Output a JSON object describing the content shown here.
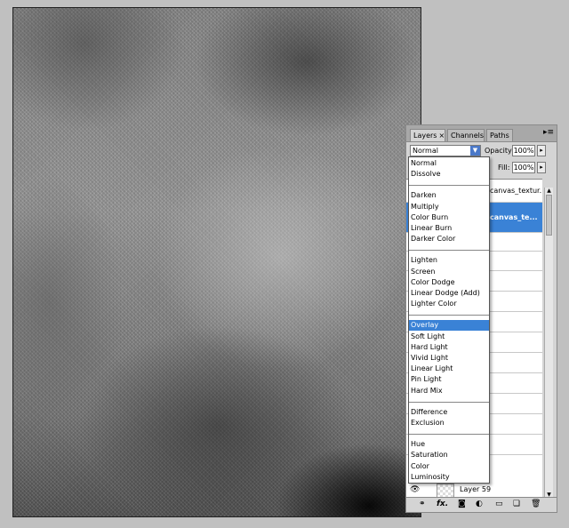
{
  "panel": {
    "tabs": [
      {
        "label": "Layers",
        "close": "×"
      },
      {
        "label": "Channels"
      },
      {
        "label": "Paths"
      }
    ],
    "menu_icon": "panel-menu-icon",
    "blend_mode": "Normal",
    "opacity_label": "Opacity:",
    "opacity_value": "100%",
    "fill_label": "Fill:",
    "fill_value": "100%",
    "layers": [
      {
        "name": "canvas_textur..."
      },
      {
        "name": "canvas_te..."
      },
      {
        "name": "Layer 59"
      }
    ],
    "footer_icons": [
      "link-icon",
      "fx-icon",
      "mask-icon",
      "adjustment-icon",
      "group-icon",
      "new-layer-icon",
      "trash-icon"
    ],
    "footer_fx_label": "fx."
  },
  "dropdown": {
    "groups": [
      [
        "Normal",
        "Dissolve"
      ],
      [
        "Darken",
        "Multiply",
        "Color Burn",
        "Linear Burn",
        "Darker Color"
      ],
      [
        "Lighten",
        "Screen",
        "Color Dodge",
        "Linear Dodge (Add)",
        "Lighter Color"
      ],
      [
        "Overlay",
        "Soft Light",
        "Hard Light",
        "Vivid Light",
        "Linear Light",
        "Pin Light",
        "Hard Mix"
      ],
      [
        "Difference",
        "Exclusion"
      ],
      [
        "Hue",
        "Saturation",
        "Color",
        "Luminosity"
      ]
    ],
    "selected": "Overlay"
  },
  "colors": {
    "selection": "#3a82d6",
    "panel_bg": "#d4d4d4",
    "workspace_bg": "#c0c0c0"
  }
}
